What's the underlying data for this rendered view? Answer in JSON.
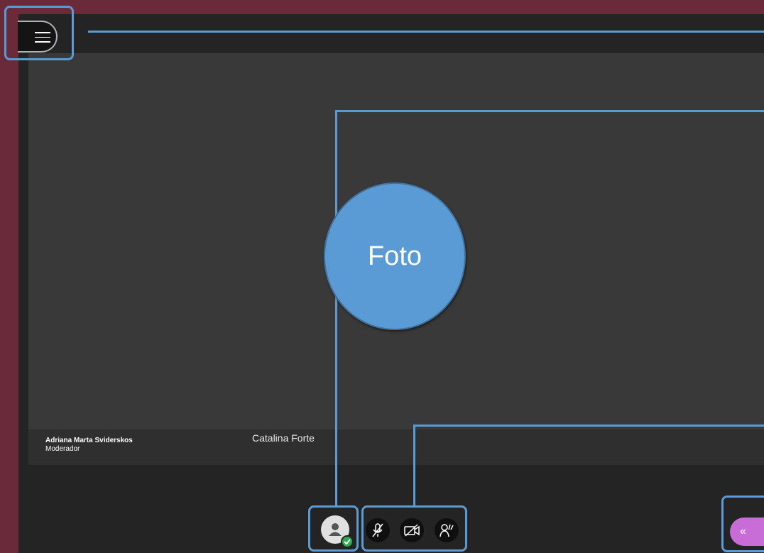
{
  "presenter": {
    "name": "Adriana Marta Sviderskos",
    "role": "Moderador"
  },
  "current_user": {
    "name": "Catalina Forte"
  },
  "callout": {
    "foto_label": "Foto"
  },
  "icons": {
    "menu": "hamburger-menu-icon",
    "avatar": "user-avatar-icon",
    "status": "check-badge-icon",
    "mic": "microphone-muted-icon",
    "camera": "camera-off-icon",
    "hand": "raise-hand-icon",
    "collapse": "double-chevron-left-icon"
  },
  "colors": {
    "frame": "#6b2a3a",
    "highlight": "#5b9bd5",
    "collapse_button": "#c86dd7",
    "status_green": "#2eaa4f"
  }
}
